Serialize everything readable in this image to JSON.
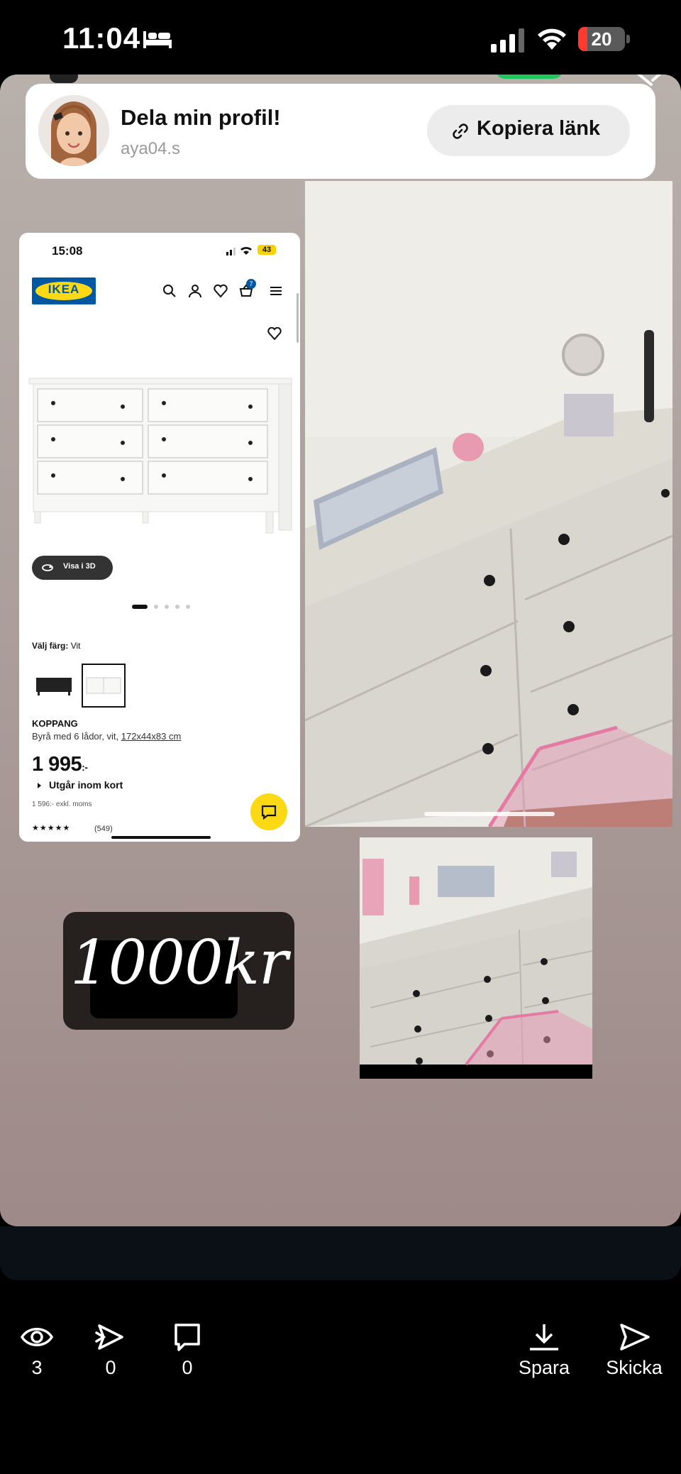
{
  "status_bar": {
    "time": "11:04",
    "battery_percent": 20,
    "battery_label": "20",
    "icons": [
      "bed-icon",
      "cellular-signal-icon",
      "wifi-icon",
      "battery-icon"
    ]
  },
  "share_card": {
    "title": "Dela min profil!",
    "username": "aya04.s",
    "copy_link_label": "Kopiera länk",
    "copy_icon": "link-icon"
  },
  "ikea_screenshot": {
    "time": "15:08",
    "battery": "43",
    "brand": "IKEA",
    "cart_count": "7",
    "view_3d_label": "Visa i 3D",
    "image_page_count": 5,
    "image_page_active": 1,
    "color_label_prefix": "Välj färg:",
    "color_value": "Vit",
    "product_name": "KOPPANG",
    "product_desc_prefix": "Byrå med 6 lådor, vit, ",
    "product_dims": "172x44x83 cm",
    "price": "1 995",
    "price_suffix": ":-",
    "stock": "Utgår inom kort",
    "price_excl": "1 596:- exkl. moms",
    "rating_stars": "★★★★★",
    "rating": 4.5,
    "reviews": "(549)",
    "colors": {
      "brand_blue": "#0058a3",
      "brand_yellow": "#fbd914"
    }
  },
  "price_sticker": {
    "text": "1000kr"
  },
  "bottom_bar": {
    "views_count": "3",
    "replays_count": "0",
    "comments_count": "0",
    "save_label": "Spara",
    "send_label": "Skicka"
  }
}
